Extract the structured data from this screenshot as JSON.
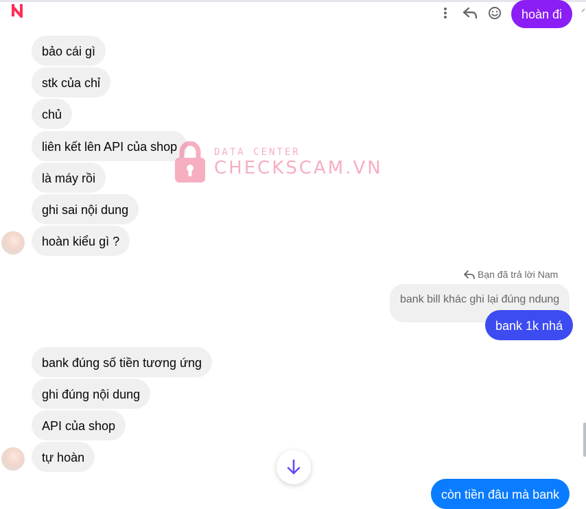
{
  "colors": {
    "incoming_bubble": "#f0f0f0",
    "outgoing_purple": "#8a1ef5",
    "outgoing_blue": "#3d4cf0",
    "outgoing_bright": "#0a7cff",
    "brand_logo": "#ff2d55"
  },
  "header": {
    "icons": [
      "more-vertical-icon",
      "reply-icon",
      "emoji-icon"
    ]
  },
  "messages_top": {
    "outgoing_first": "hoàn đi"
  },
  "incoming_group_1": [
    "bảo cái gì",
    "stk của chỉ",
    "chủ",
    "liên kết lên API của shop",
    "là máy rồi",
    "ghi sai nội dung",
    "hoàn kiểu gì ?"
  ],
  "watermark": {
    "line1": "DATA CENTER",
    "line2": "CHECKSCAM.VN"
  },
  "reply": {
    "note": "Bạn đã trả lời Nam",
    "quoted_text": "bank bill khác ghi lại đúng ndung",
    "reply_text": "bank 1k nhá"
  },
  "incoming_group_2": [
    "bank đúng số tiền tương ứng",
    "ghi đúng nội dung",
    "API của shop",
    "tự hoàn"
  ],
  "outgoing_last": "còn tiền đâu mà bank"
}
